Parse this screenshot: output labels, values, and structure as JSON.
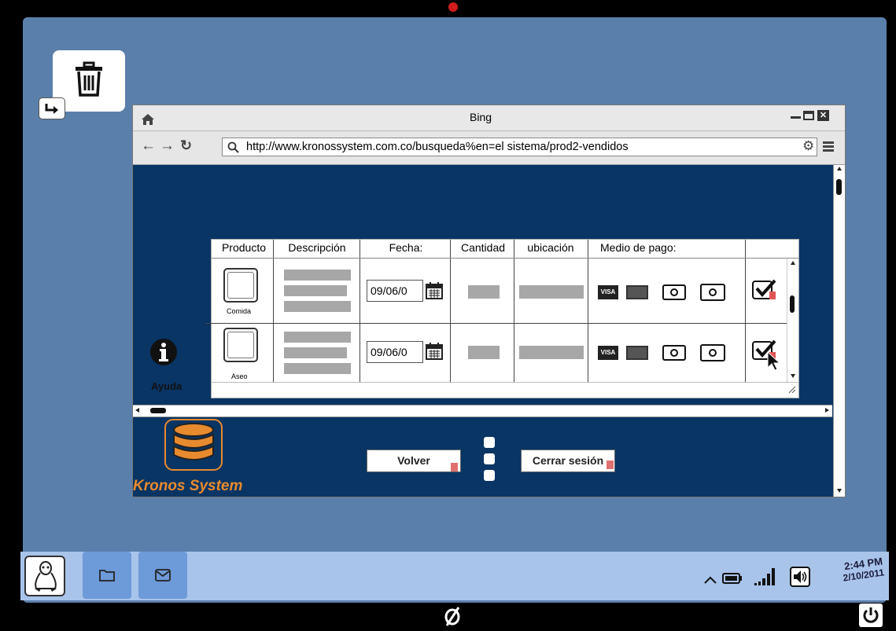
{
  "browser": {
    "title": "Bing",
    "url": "http://www.kronossystem.com.co/busqueda%en=el sistema/prod2-vendidos"
  },
  "help": {
    "label": "Ayuda"
  },
  "table": {
    "headers": [
      "Producto",
      "Descripción",
      "Fecha:",
      "Cantidad",
      "ubicación",
      "Medio de pago:"
    ],
    "rows": [
      {
        "product_caption": "Comida",
        "date": "09/06/0"
      },
      {
        "product_caption": "Aseo",
        "date": "09/06/0"
      }
    ],
    "payment_methods": [
      "VISA",
      "card",
      "cash",
      "cash"
    ]
  },
  "logo": {
    "name": "Kronos System",
    "color": "#e88a2e"
  },
  "buttons": {
    "back": "Volver",
    "logout": "Cerrar sesión"
  },
  "system": {
    "time": "2:44 PM",
    "date": "2/10/2011"
  },
  "colors": {
    "desktop": "#5b7fab",
    "page_bg": "#083564",
    "taskbar": "#a8c4ea"
  }
}
